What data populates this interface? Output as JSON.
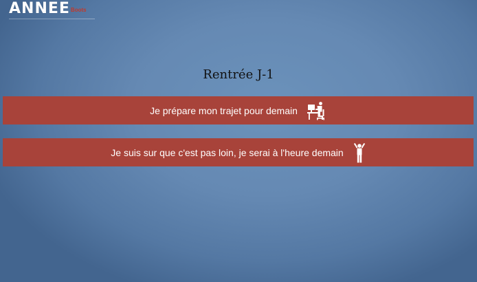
{
  "logo": {
    "main": "ANNEE",
    "sub": "Boots"
  },
  "title": "Rentrée J-1",
  "choices": [
    {
      "label": "Je prépare mon trajet pour demain",
      "icon": "person-at-desk-icon"
    },
    {
      "label": "Je suis sur que c'est pas loin, je serai à l'heure demain",
      "icon": "standing-person-icon"
    }
  ],
  "colors": {
    "background": "#6589b3",
    "button": "#a8433a",
    "button_text": "#ffffff",
    "title_text": "#111111",
    "logo_accent": "#c0392b"
  }
}
